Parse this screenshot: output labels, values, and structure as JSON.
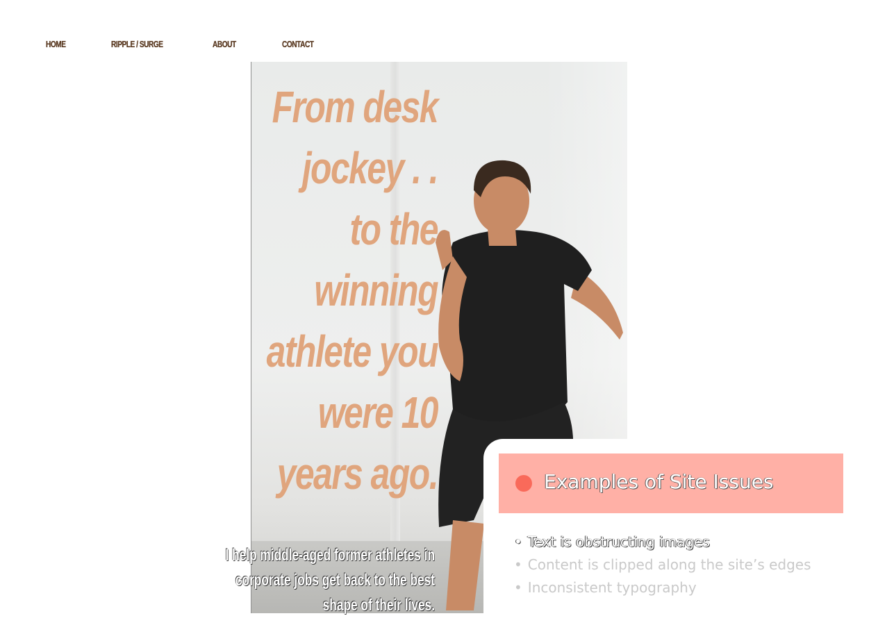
{
  "nav": {
    "items": [
      {
        "label": "HOME"
      },
      {
        "label": "RIPPLE / SURGE"
      },
      {
        "label": "ABOUT"
      },
      {
        "label": "CONTACT"
      }
    ]
  },
  "hero": {
    "headline_lines": [
      "From desk",
      "jockey . .",
      "to the",
      "winning",
      "athlete you",
      "were 10",
      "years ago."
    ],
    "subtext_lines": [
      "I help middle-aged former athletes in",
      "corporate jobs get back to the best",
      "shape of their lives."
    ],
    "image": "athlete-sprinting-photo",
    "headline_color": "#e0a57d"
  },
  "issues": {
    "title": "Examples of Site Issues",
    "dot_color": "#f96a5a",
    "header_color": "#ffb0a6",
    "items": [
      {
        "bullet": "•",
        "text": "Text is obstructing images"
      },
      {
        "bullet": "•",
        "text": "Content is clipped along the site’s edges"
      },
      {
        "bullet": "•",
        "text": "Inconsistent typography"
      }
    ]
  }
}
